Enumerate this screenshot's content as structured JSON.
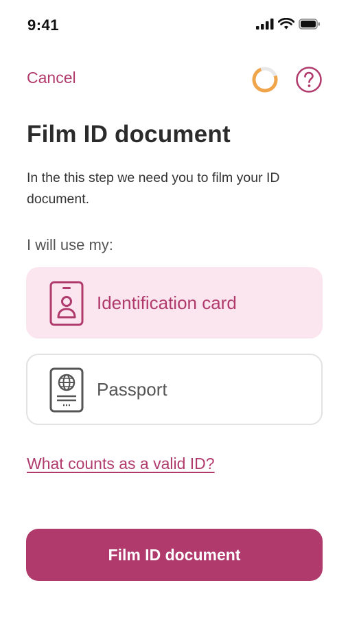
{
  "status_bar": {
    "time": "9:41",
    "icons": [
      "signal-icon",
      "wifi-icon",
      "battery-icon"
    ]
  },
  "nav": {
    "cancel_label": "Cancel",
    "progress_icon": "progress-ring-icon",
    "help_icon": "question-mark-icon"
  },
  "page": {
    "title": "Film ID document",
    "intro": "In the this step we need you to film your ID document.",
    "choose_label": "I will use my:"
  },
  "options": [
    {
      "label": "Identification card",
      "icon": "id-card-icon",
      "selected": true
    },
    {
      "label": "Passport",
      "icon": "passport-icon",
      "selected": false
    }
  ],
  "links": {
    "valid_id": "What counts as a valid ID?"
  },
  "actions": {
    "primary_label": "Film ID document"
  },
  "colors": {
    "accent": "#b03a6c",
    "selected_bg": "#fbe6ef",
    "progress": "#f0a54a",
    "text": "#2b2b2b"
  }
}
